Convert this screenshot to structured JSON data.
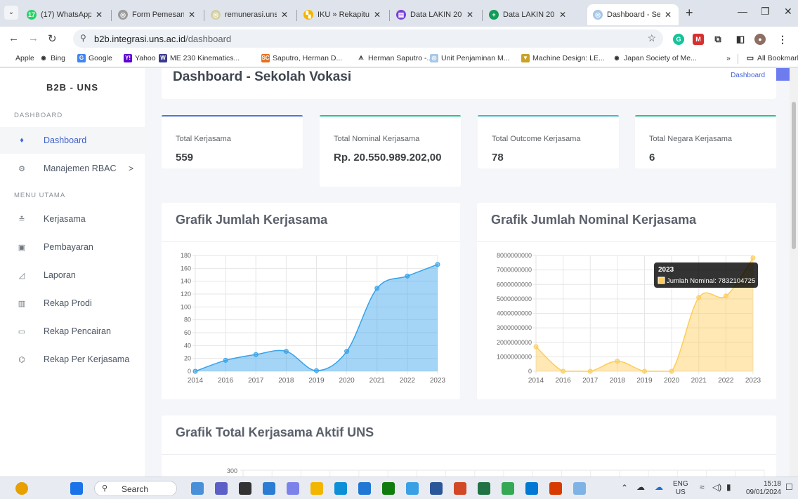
{
  "browser": {
    "tabs": [
      {
        "label": "(17) WhatsApp",
        "color": "#25d366",
        "glyph": "17"
      },
      {
        "label": "Form Pemesanan",
        "color": "#9a9a9a",
        "glyph": "◎"
      },
      {
        "label": "remunerasi.uns.ac",
        "color": "#d4d0a4",
        "glyph": "◎"
      },
      {
        "label": "IKU » Rekapitulasi",
        "color": "#f4b400",
        "glyph": "▚"
      },
      {
        "label": "Data LAKIN 2023",
        "color": "#7b3fd6",
        "glyph": "▤"
      },
      {
        "label": "Data LAKIN 2023",
        "color": "#0f9d58",
        "glyph": "+"
      },
      {
        "label": "Dashboard - Seko",
        "color": "#a7c7e7",
        "glyph": "◎"
      }
    ],
    "url_host": "b2b.integrasi.uns.ac.id",
    "url_path": "/dashboard",
    "bookmarks": [
      {
        "label": "Apple",
        "icon": "apple-icon",
        "color": "#333333",
        "glyph": ""
      },
      {
        "label": "Bing",
        "icon": "bing-icon",
        "color": "#333333",
        "glyph": "◉"
      },
      {
        "label": "Google",
        "icon": "google-icon",
        "color": "#4285f4",
        "glyph": "G"
      },
      {
        "label": "Yahoo",
        "icon": "yahoo-icon",
        "color": "#6001d2",
        "glyph": "Y!"
      },
      {
        "label": "ME 230 Kinematics...",
        "icon": "w-icon",
        "color": "#3b3b8f",
        "glyph": "W"
      },
      {
        "label": "Saputro, Herman D...",
        "icon": "sc-icon",
        "color": "#e8711a",
        "glyph": "SC"
      },
      {
        "label": "Herman Saputro -...",
        "icon": "network-icon",
        "color": "#333333",
        "glyph": "ᗑ"
      },
      {
        "label": "Unit Penjaminan M...",
        "icon": "globe-icon",
        "color": "#a7c7e7",
        "glyph": "◎"
      },
      {
        "label": "Machine Design: LE...",
        "icon": "trophy-icon",
        "color": "#c9a227",
        "glyph": "▼"
      },
      {
        "label": "Japan Society of Me...",
        "icon": "globe-icon",
        "color": "#333333",
        "glyph": "◉"
      }
    ],
    "bookmarks_more": "»",
    "all_bookmarks": "All Bookmarks"
  },
  "sidebar": {
    "brand": "B2B - UNS",
    "section_dashboard": "DASHBOARD",
    "section_menu": "MENU UTAMA",
    "items": [
      {
        "label": "Dashboard",
        "icon": "drop-icon",
        "glyph": "♦"
      },
      {
        "label": "Manajemen RBAC",
        "icon": "gears-icon",
        "glyph": "⚙",
        "arrow": ">"
      },
      {
        "label": "Kerjasama",
        "icon": "users-icon",
        "glyph": "≛"
      },
      {
        "label": "Pembayaran",
        "icon": "money-icon",
        "glyph": "▣"
      },
      {
        "label": "Laporan",
        "icon": "chart-area-icon",
        "glyph": "◿"
      },
      {
        "label": "Rekap Prodi",
        "icon": "building-icon",
        "glyph": "▥"
      },
      {
        "label": "Rekap Pencairan",
        "icon": "card-icon",
        "glyph": "▭"
      },
      {
        "label": "Rekap Per Kerjasama",
        "icon": "handshake-icon",
        "glyph": "⌬"
      }
    ]
  },
  "page": {
    "title": "Dashboard - Sekolah Vokasi",
    "breadcrumb": "Dashboard"
  },
  "stats": [
    {
      "label": "Total Kerjasama",
      "value": "559",
      "color": "#4e73df"
    },
    {
      "label": "Total Nominal Kerjasama",
      "value": "Rp. 20.550.989.202,00",
      "color": "#1cc88a"
    },
    {
      "label": "Total Outcome Kerjasama",
      "value": "78",
      "color": "#36b9cc"
    },
    {
      "label": "Total Negara Kerjasama",
      "value": "6",
      "color": "#1cc88a"
    }
  ],
  "chart_titles": {
    "jumlah": "Grafik Jumlah Kerjasama",
    "nominal": "Grafik Jumlah Nominal Kerjasama",
    "aktif": "Grafik Total Kerjasama Aktif UNS"
  },
  "chart_data": [
    {
      "type": "area",
      "title": "Grafik Jumlah Kerjasama",
      "categories": [
        "2014",
        "2016",
        "2017",
        "2018",
        "2019",
        "2020",
        "2021",
        "2022",
        "2023"
      ],
      "series": [
        {
          "values": [
            0,
            17,
            26,
            31,
            1,
            31,
            129,
            148,
            166
          ]
        }
      ],
      "ylim": [
        0,
        180
      ],
      "yticks": [
        0,
        20,
        40,
        60,
        80,
        100,
        120,
        140,
        160,
        180
      ],
      "grid": true,
      "color": "#36a2eb"
    },
    {
      "type": "area",
      "title": "Grafik Jumlah Nominal Kerjasama",
      "categories": [
        "2014",
        "2016",
        "2017",
        "2018",
        "2019",
        "2020",
        "2021",
        "2022",
        "2023"
      ],
      "series": [
        {
          "name": "Jumlah Nominal",
          "values": [
            1700000000,
            0,
            0,
            700000000,
            0,
            0,
            5100000000,
            5200000000,
            7832104725
          ]
        }
      ],
      "ylim": [
        0,
        8000000000
      ],
      "yticks": [
        0,
        1000000000,
        2000000000,
        3000000000,
        4000000000,
        5000000000,
        6000000000,
        7000000000,
        8000000000
      ],
      "grid": true,
      "color": "#ffcd56",
      "tooltip": {
        "title": "2023",
        "text": "Jumlah Nominal: 7832104725"
      }
    },
    {
      "type": "bar",
      "title": "Grafik Total Kerjasama Aktif UNS",
      "yticks": [
        300
      ],
      "grid": true
    }
  ],
  "taskbar": {
    "search_label": "Search",
    "lang_top": "ENG",
    "lang_bottom": "US",
    "time": "15:18",
    "date": "09/01/2024"
  }
}
